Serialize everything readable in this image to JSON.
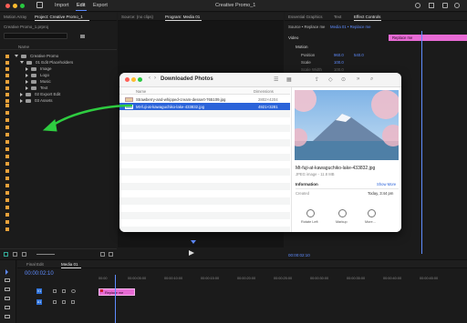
{
  "app": {
    "title": "Creative Promo_1",
    "nav": [
      "Import",
      "Edit",
      "Export"
    ],
    "active_nav": "Edit"
  },
  "project_panel": {
    "tabs": [
      "Motion Array",
      "Project: Creative Promo_1"
    ],
    "project_file": "Creative Promo_1.prproj",
    "column_header": "Name",
    "tree": [
      {
        "label": "Creative Promo",
        "level": 0,
        "expanded": true
      },
      {
        "label": "01 Edit Placeholders",
        "level": 1,
        "expanded": true
      },
      {
        "label": "Image",
        "level": 2
      },
      {
        "label": "Logo",
        "level": 2
      },
      {
        "label": "Music",
        "level": 2
      },
      {
        "label": "Text",
        "level": 2
      },
      {
        "label": "02 Export Edit",
        "level": 1
      },
      {
        "label": "03 Assets",
        "level": 1
      }
    ]
  },
  "source_panel": {
    "tabs": [
      "Source: (no clips)",
      "Program: Media 01"
    ]
  },
  "effects_panel": {
    "tabs": [
      "Essential Graphics",
      "Text",
      "Effect Controls"
    ],
    "source_label": "Source • Replace me",
    "clip_label": "Media 01 • Replace me",
    "clip_name": "Replace me",
    "section": "Video",
    "fx": "Motion",
    "properties": [
      {
        "name": "Position",
        "value1": "960.0",
        "value2": "540.0"
      },
      {
        "name": "Scale",
        "value1": "100.0",
        "value2": ""
      },
      {
        "name": "Scale Width",
        "value1": "100.0",
        "value2": ""
      }
    ],
    "timecode": "00:00:02:10"
  },
  "timeline": {
    "tabs": [
      "Final Edit",
      "Media 01"
    ],
    "timecode": "00:00:02:10",
    "ruler": [
      "00:00",
      "00:00:05:00",
      "00:00:10:00",
      "00:00:15:00",
      "00:00:20:00",
      "00:00:25:00",
      "00:00:30:00",
      "00:00:35:00",
      "00:00:40:00",
      "00:00:45:00"
    ],
    "clip_name": "Replace me",
    "tracks": [
      "V1",
      "A1"
    ]
  },
  "finder": {
    "title": "Downloaded Photos",
    "columns": {
      "name": "Name",
      "dimensions": "Dimensions"
    },
    "files": [
      {
        "name": "Strawberry-and-whipped-cream-dessert-765109.jpg",
        "dimensions": "2802×4204",
        "selected": false
      },
      {
        "name": "Mt-fuji-at-kawaguchiko-lake-433832.jpg",
        "dimensions": "4921×3281",
        "selected": true
      }
    ],
    "preview": {
      "file_name": "Mt-fuji-at-kawaguchiko-lake-433832.jpg",
      "file_info": "JPEG image - 11.8 MB",
      "information_label": "Information",
      "show_more": "Show More",
      "created_label": "Created",
      "created_value": "Today, 3:44 pm",
      "actions": [
        "Rotate Left",
        "Markup",
        "More..."
      ]
    }
  },
  "colors": {
    "accent_blue": "#2b63d9",
    "clip_pink": "#e86bd5",
    "premiere_blue": "#5f8cff",
    "arrow_green": "#2ecc40"
  }
}
